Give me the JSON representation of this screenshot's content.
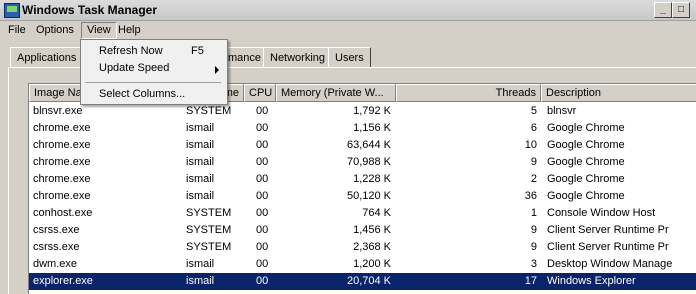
{
  "window": {
    "title": "Windows Task Manager"
  },
  "menubar": [
    "File",
    "Options",
    "View",
    "Help"
  ],
  "view_menu": {
    "refresh_now": "Refresh Now",
    "refresh_shortcut": "F5",
    "update_speed": "Update Speed",
    "select_columns": "Select Columns..."
  },
  "tabs": {
    "applications": "Applications",
    "performance_partial": "mance",
    "networking": "Networking",
    "users": "Users"
  },
  "columns": {
    "image_name": "Image Na",
    "user_partial": "me",
    "cpu": "CPU",
    "memory": "Memory (Private W...",
    "threads": "Threads",
    "description": "Description"
  },
  "rows": [
    {
      "name": "blnsvr.exe",
      "user": "SYSTEM",
      "cpu": "00",
      "mem": "1,792 K",
      "threads": "5",
      "desc": "blnsvr"
    },
    {
      "name": "chrome.exe",
      "user": "ismail",
      "cpu": "00",
      "mem": "1,156 K",
      "threads": "6",
      "desc": "Google Chrome"
    },
    {
      "name": "chrome.exe",
      "user": "ismail",
      "cpu": "00",
      "mem": "63,644 K",
      "threads": "10",
      "desc": "Google Chrome"
    },
    {
      "name": "chrome.exe",
      "user": "ismail",
      "cpu": "00",
      "mem": "70,988 K",
      "threads": "9",
      "desc": "Google Chrome"
    },
    {
      "name": "chrome.exe",
      "user": "ismail",
      "cpu": "00",
      "mem": "1,228 K",
      "threads": "2",
      "desc": "Google Chrome"
    },
    {
      "name": "chrome.exe",
      "user": "ismail",
      "cpu": "00",
      "mem": "50,120 K",
      "threads": "36",
      "desc": "Google Chrome"
    },
    {
      "name": "conhost.exe",
      "user": "SYSTEM",
      "cpu": "00",
      "mem": "764 K",
      "threads": "1",
      "desc": "Console Window Host"
    },
    {
      "name": "csrss.exe",
      "user": "SYSTEM",
      "cpu": "00",
      "mem": "1,456 K",
      "threads": "9",
      "desc": "Client Server Runtime Pr"
    },
    {
      "name": "csrss.exe",
      "user": "SYSTEM",
      "cpu": "00",
      "mem": "2,368 K",
      "threads": "9",
      "desc": "Client Server Runtime Pr"
    },
    {
      "name": "dwm.exe",
      "user": "ismail",
      "cpu": "00",
      "mem": "1,200 K",
      "threads": "3",
      "desc": "Desktop Window Manage"
    },
    {
      "name": "explorer.exe",
      "user": "ismail",
      "cpu": "00",
      "mem": "20,704 K",
      "threads": "17",
      "desc": "Windows Explorer"
    }
  ],
  "selected_row": 10,
  "colors": {
    "selection": "#0a246a",
    "window_bg": "#d4d0c8"
  }
}
